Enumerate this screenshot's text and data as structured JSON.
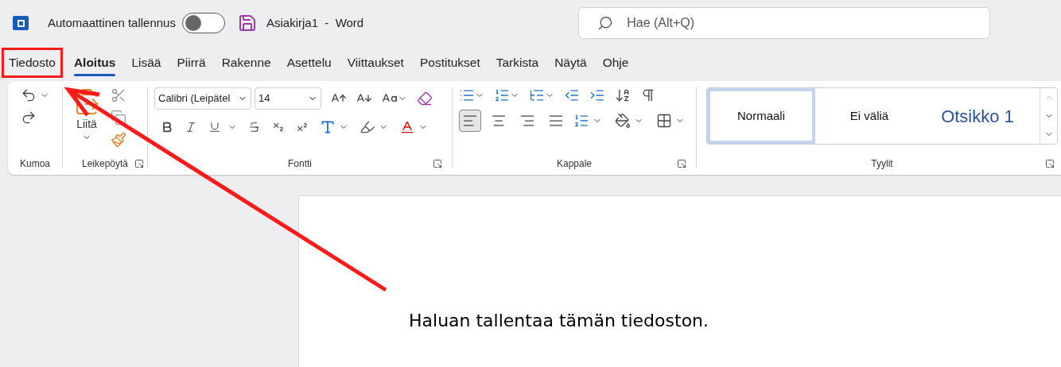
{
  "title_bar": {
    "autosave_label": "Automaattinen tallennus",
    "autosave_on": false,
    "document_title": "Asiakirja1  -  Word"
  },
  "search": {
    "placeholder": "Hae (Alt+Q)"
  },
  "tabs": [
    {
      "label": "Tiedosto",
      "selected": false,
      "annotated": true
    },
    {
      "label": "Aloitus",
      "selected": true,
      "annotated": false
    },
    {
      "label": "Lisää",
      "selected": false,
      "annotated": false
    },
    {
      "label": "Piirrä",
      "selected": false,
      "annotated": false
    },
    {
      "label": "Rakenne",
      "selected": false,
      "annotated": false
    },
    {
      "label": "Asettelu",
      "selected": false,
      "annotated": false
    },
    {
      "label": "Viittaukset",
      "selected": false,
      "annotated": false
    },
    {
      "label": "Postitukset",
      "selected": false,
      "annotated": false
    },
    {
      "label": "Tarkista",
      "selected": false,
      "annotated": false
    },
    {
      "label": "Näytä",
      "selected": false,
      "annotated": false
    },
    {
      "label": "Ohje",
      "selected": false,
      "annotated": false
    }
  ],
  "ribbon": {
    "group_labels": [
      "Kumoa",
      "Leikepöytä",
      "Fontti",
      "Kappale",
      "Tyylit"
    ],
    "paste_label": "Liitä",
    "font_name": "Calibri (Leipätel",
    "font_size": "14",
    "alignments": [
      {
        "kind": "left",
        "selected": true
      },
      {
        "kind": "center",
        "selected": false
      },
      {
        "kind": "right",
        "selected": false
      },
      {
        "kind": "justify",
        "selected": false
      }
    ],
    "styles": [
      {
        "label": "Normaali",
        "kind": "normal",
        "selected": true
      },
      {
        "label": "Ei väliä",
        "kind": "normal",
        "selected": false
      },
      {
        "label": "Otsikko 1",
        "kind": "heading",
        "selected": false
      }
    ]
  },
  "document": {
    "text": "Haluan tallentaa tämän tiedoston."
  },
  "annotation_arrow": true
}
